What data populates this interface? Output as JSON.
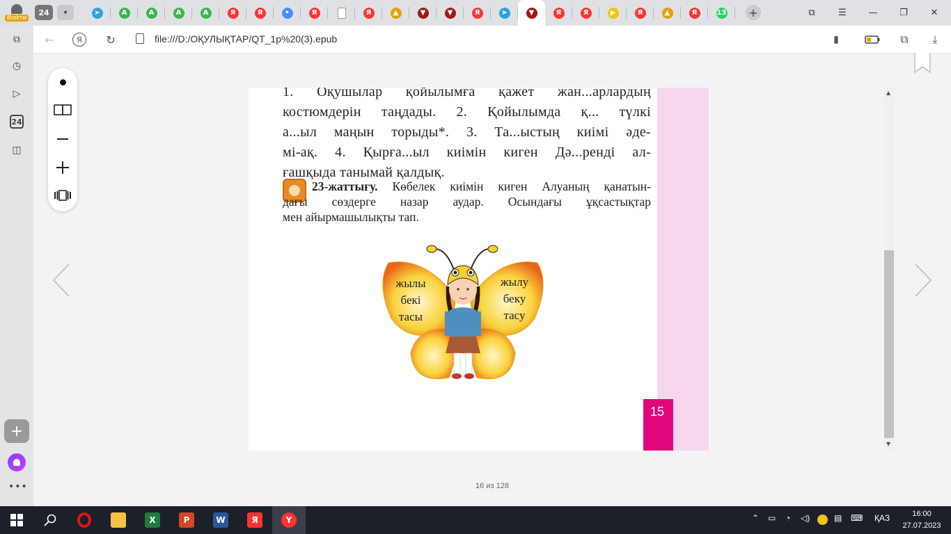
{
  "browser": {
    "login_label": "Войти",
    "tab_count": "24",
    "url": "file:///D:/ОҚУЛЫҚТАР/QT_1р%20(3).epub",
    "tabs": [
      {
        "icon": "telegram-icon",
        "color": "#2aa3dd",
        "glyph": "➤"
      },
      {
        "icon": "green-a-icon",
        "color": "#3cb54a",
        "glyph": "A"
      },
      {
        "icon": "green-a-icon",
        "color": "#3cb54a",
        "glyph": "A"
      },
      {
        "icon": "green-a-icon",
        "color": "#3cb54a",
        "glyph": "A"
      },
      {
        "icon": "green-a-icon",
        "color": "#3cb54a",
        "glyph": "A"
      },
      {
        "icon": "yandex-icon",
        "color": "#f33",
        "glyph": "Я"
      },
      {
        "icon": "yandex-icon",
        "color": "#f33",
        "glyph": "Я"
      },
      {
        "icon": "dots-icon",
        "color": "#4a8cff",
        "glyph": "•"
      },
      {
        "icon": "yandex-icon",
        "color": "#f33",
        "glyph": "Я"
      },
      {
        "icon": "document-icon",
        "color": "#9a9a9a",
        "glyph": ""
      },
      {
        "icon": "yandex-icon",
        "color": "#f33",
        "glyph": "Я"
      },
      {
        "icon": "image-icon",
        "color": "#e3a200",
        "glyph": "▲"
      },
      {
        "icon": "shield-icon",
        "color": "#a01818",
        "glyph": "▼"
      },
      {
        "icon": "shield-icon",
        "color": "#a01818",
        "glyph": "▼"
      },
      {
        "icon": "yandex-icon",
        "color": "#f33",
        "glyph": "Я"
      },
      {
        "icon": "telegram-icon",
        "color": "#2aa3dd",
        "glyph": "➤"
      },
      {
        "icon": "shield-icon",
        "color": "#a01818",
        "glyph": "▼",
        "active": true
      },
      {
        "icon": "yandex-icon",
        "color": "#f33",
        "glyph": "Я"
      },
      {
        "icon": "yandex-icon",
        "color": "#f33",
        "glyph": "Я"
      },
      {
        "icon": "play-icon",
        "color": "#f5c400",
        "glyph": "▶"
      },
      {
        "icon": "yandex-icon",
        "color": "#f33",
        "glyph": "Я"
      },
      {
        "icon": "image-icon",
        "color": "#e3a200",
        "glyph": "▲"
      },
      {
        "icon": "yandex-icon",
        "color": "#f33",
        "glyph": "Я"
      },
      {
        "icon": "whatsapp-icon",
        "color": "#25d366",
        "glyph": "13"
      }
    ]
  },
  "sidebar": {
    "badge_24": "24"
  },
  "book": {
    "para1_lines": [
      "1. Оқушылар қойылымға қажет жан...арлардың",
      "костюмдерін таңдады. 2. Қойылымда қ... түлкі",
      "а...ыл маңын торыды*. 3. Та...ыстың киімі әде-",
      "мі-ақ. 4. Қырға...ыл киімін киген Дә...ренді ал-",
      "ғашқыда танымай қалдық."
    ],
    "exercise_label": "23-жаттығу.",
    "para2_lines": [
      "Көбелек киімін киген Алуаның қанатын-",
      "дағы сөздерге назар аудар. Осындағы ұқсастықтар",
      "мен айырмашылықты тап."
    ],
    "wing_left": [
      "жылы",
      "бекі",
      "тасы"
    ],
    "wing_right": [
      "жылу",
      "беку",
      "тасу"
    ],
    "page_number": "15",
    "page_indicator": "16 из 128",
    "colors": {
      "accent_pink": "#e0077d",
      "margin_pink": "#f7d7ee",
      "exercise_orange": "#e88a26"
    }
  },
  "taskbar": {
    "apps": [
      {
        "name": "start-icon"
      },
      {
        "name": "search-icon"
      },
      {
        "name": "opera-icon"
      },
      {
        "name": "file-explorer-icon"
      },
      {
        "name": "excel-icon"
      },
      {
        "name": "powerpoint-icon"
      },
      {
        "name": "word-icon"
      },
      {
        "name": "yandex-browser-icon"
      },
      {
        "name": "yandex-icon"
      }
    ],
    "lang": "ҚАЗ",
    "time": "16:00",
    "date": "27.07.2023"
  }
}
